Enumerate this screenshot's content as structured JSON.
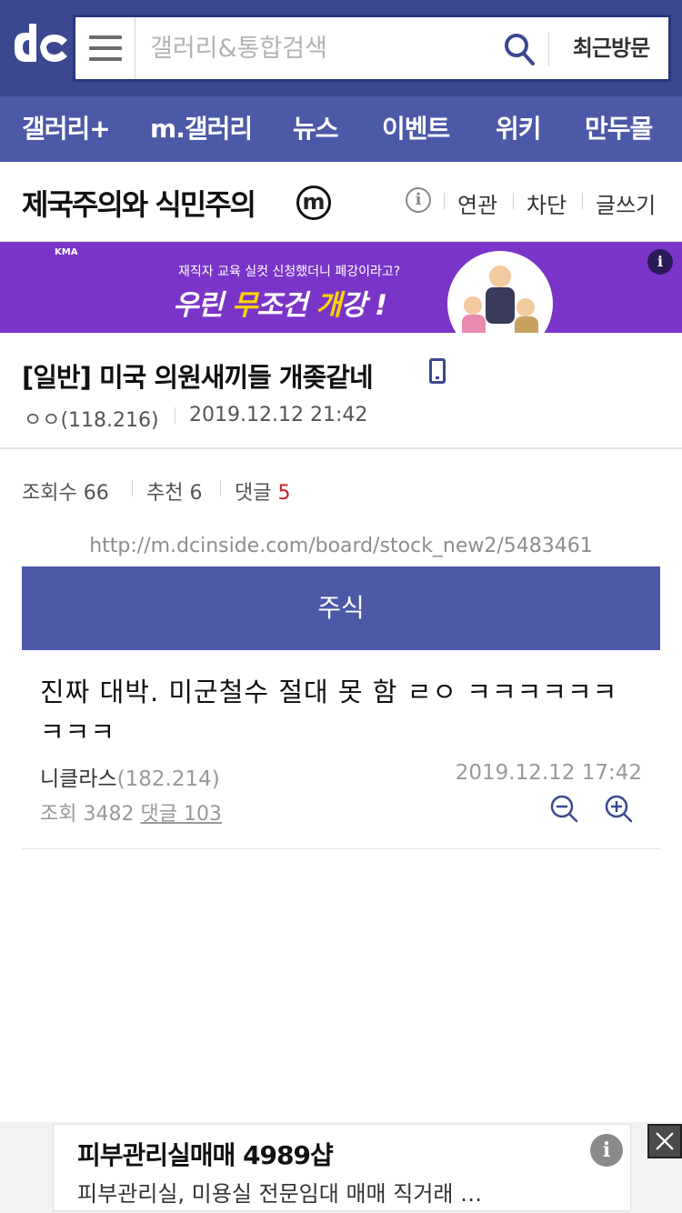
{
  "header": {
    "search_placeholder": "갤러리&통합검색",
    "recent_label": "최근방문"
  },
  "nav": [
    "갤러리+",
    "m.갤러리",
    "뉴스",
    "이벤트",
    "위키",
    "만두몰"
  ],
  "gallery": {
    "title": "제국주의와 식민주의",
    "badge": "m",
    "info_icon": "i",
    "links": [
      "연관",
      "차단",
      "글쓰기"
    ]
  },
  "ad_banner": {
    "brand": "KMA",
    "subtitle": "재직자 교육 실컷 신청했더니 폐강이라고?",
    "headline_a": "우린 ",
    "headline_b": "무",
    "headline_c": "조건 ",
    "headline_d": "개",
    "headline_e": "강 !",
    "info_icon": "i"
  },
  "post": {
    "title": "[일반] 미국 의원새끼들 개좆같네",
    "author": "ㅇㅇ(118.216)",
    "date": "2019.12.12 21:42"
  },
  "stats": {
    "views_label": "조회수",
    "views": "66",
    "recommend_label": "추천",
    "recommend": "6",
    "comments_label": "댓글",
    "comments": "5"
  },
  "url": "http://m.dcinside.com/board/stock_new2/5483461",
  "category_button": "주식",
  "related": {
    "title": "진짜 대박. 미군철수 절대 못 함 ㄹㅇ ㅋㅋㅋㅋㅋㅋㅋㅋㅋ",
    "author": "니클라스",
    "author_ip": "(182.214)",
    "date": "2019.12.12 17:42",
    "views_text": "조회 3482",
    "comments_text": "댓글 103"
  },
  "bottom_ad": {
    "title": "피부관리실매매 4989샵",
    "subtitle": "피부관리실, 미용실 전문임대 매매 직거래 …",
    "info_icon": "i"
  },
  "colors": {
    "header": "#3b4890",
    "nav": "#4b59a7",
    "ad_purple": "#7a35c8",
    "accent_red": "#d01d1d"
  }
}
